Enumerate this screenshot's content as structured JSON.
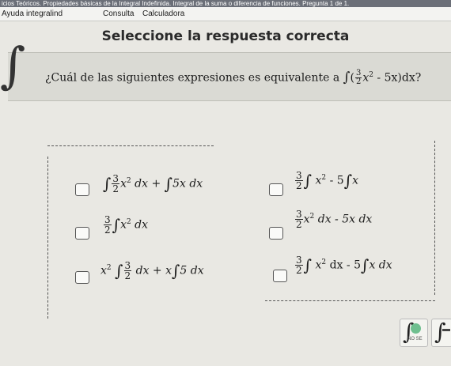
{
  "top_banner": "icios Teóricos. Propiedades básicas de la Integral Indefinida. Integral de la suma o diferencia de funciones. Pregunta 1 de 1.",
  "menu": {
    "help": "Ayuda integralind",
    "consult": "Consulta",
    "calculator": "Calculadora"
  },
  "heading": "Seleccione la respuesta correcta",
  "question": {
    "prefix": "¿Cuál de las siguientes expresiones es equivalente a",
    "expr_num": "3",
    "expr_den": "2",
    "expr_x2": "x",
    "expr_exp": "2",
    "expr_rest": " - 5x)dx?",
    "open_paren": "("
  },
  "options": [
    {
      "coef_num": "3",
      "coef_den": "2",
      "t1": "x",
      "t1_exp": "2",
      "t1_tail": " dx + ",
      "t2": "5x dx"
    },
    {
      "coef_num": "3",
      "coef_den": "2",
      "t1": "x",
      "t1_exp": "2",
      "t1_tail": " - 5",
      "t2": "x"
    },
    {
      "coef_num": "3",
      "coef_den": "2",
      "t1": "x",
      "t1_exp": "2",
      "t1_tail": " dx"
    },
    {
      "coef_num": "3",
      "coef_den": "2",
      "t1": "x",
      "t1_exp": "2",
      "t1_tail": " dx - 5x dx"
    },
    {
      "lead": "x",
      "lead_exp": "2",
      "coef_num": "3",
      "coef_den": "2",
      "t1_tail": " dx + x",
      "t2": "5 dx"
    },
    {
      "coef_num": "3",
      "coef_den": "2",
      "t1": "x",
      "t1_exp": "2",
      "t1_tail": " dx - 5",
      "t2": "x dx"
    }
  ],
  "corner_badge": "NO SE",
  "colors": {
    "topbar": "#6b6f78",
    "band": "#dadad4",
    "badge": "#6fbf8f"
  }
}
